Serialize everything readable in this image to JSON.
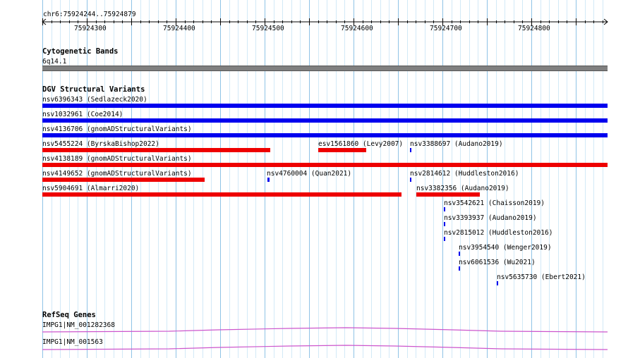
{
  "ruler": {
    "region": "chr6:75924244..75924879",
    "ticks": [
      "75924300",
      "75924400",
      "75924500",
      "75924600",
      "75924700",
      "75924800"
    ]
  },
  "colors": {
    "grid_major": "#8fc3e6",
    "grid_minor": "#d2e9f7",
    "band": "#808080",
    "variant_gain": "#0000ee",
    "variant_loss": "#ee0000",
    "gene": "#cc55cc"
  },
  "tracks": {
    "cytobands": {
      "title": "Cytogenetic Bands",
      "band_label": "6q14.1"
    },
    "dgv": {
      "title": "DGV Structural Variants",
      "features": [
        {
          "label": "nsv6396343 (Sedlazeck2020)",
          "type": "gain"
        },
        {
          "label": "nsv1032961 (Coe2014)",
          "type": "gain"
        },
        {
          "label": "nsv4136706 (gnomADStructuralVariants)",
          "type": "gain"
        },
        {
          "label": "nsv5455224 (ByrskaBishop2022)",
          "type": "loss"
        },
        {
          "label": "esv1561860 (Levy2007)",
          "type": "loss"
        },
        {
          "label": "nsv3388697 (Audano2019)",
          "type": "gain"
        },
        {
          "label": "nsv4138189 (gnomADStructuralVariants)",
          "type": "loss"
        },
        {
          "label": "nsv4149652 (gnomADStructuralVariants)",
          "type": "loss"
        },
        {
          "label": "nsv4760004 (Quan2021)",
          "type": "gain"
        },
        {
          "label": "nsv2814612 (Huddleston2016)",
          "type": "gain"
        },
        {
          "label": "nsv5904691 (Almarri2020)",
          "type": "loss"
        },
        {
          "label": "nsv3382356 (Audano2019)",
          "type": "loss"
        },
        {
          "label": "nsv3542621 (Chaisson2019)",
          "type": "gain"
        },
        {
          "label": "nsv3393937 (Audano2019)",
          "type": "gain"
        },
        {
          "label": "nsv2815012 (Huddleston2016)",
          "type": "gain"
        },
        {
          "label": "nsv3954540 (Wenger2019)",
          "type": "gain"
        },
        {
          "label": "nsv6061536 (Wu2021)",
          "type": "gain"
        },
        {
          "label": "nsv5635730 (Ebert2021)",
          "type": "gain"
        }
      ]
    },
    "refseq": {
      "title": "RefSeq Genes",
      "genes": [
        {
          "label": "IMPG1|NM_001282368"
        },
        {
          "label": "IMPG1|NM_001563"
        }
      ]
    }
  }
}
